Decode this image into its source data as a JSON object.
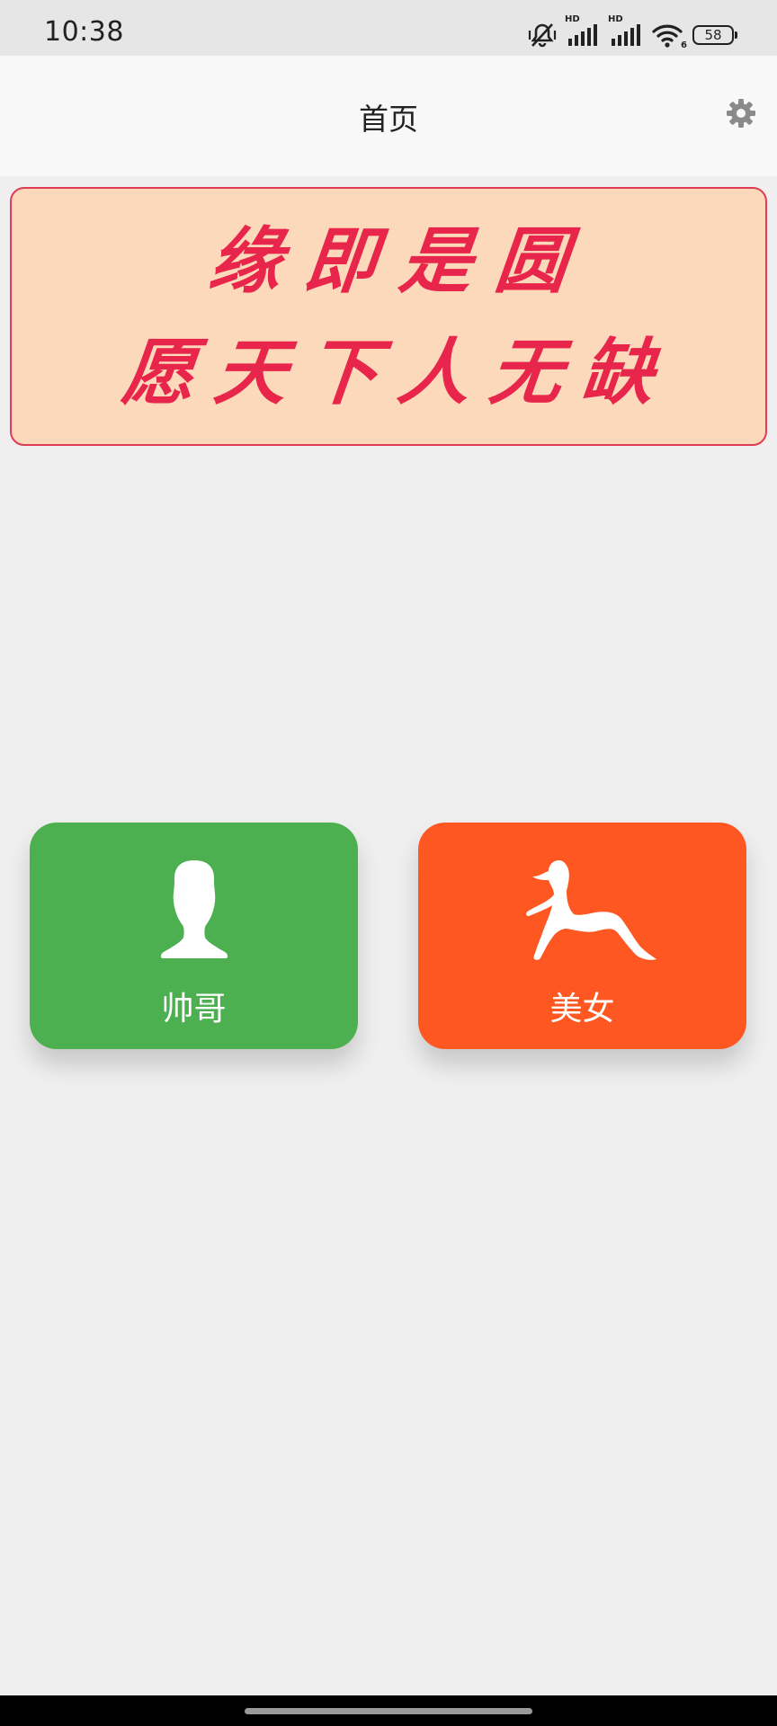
{
  "status_bar": {
    "time": "10:38",
    "battery": "58",
    "signal_label_1": "HD",
    "signal_label_2": "HD",
    "wifi_label": "6"
  },
  "app_bar": {
    "title": "首页",
    "settings_icon": "gear-icon"
  },
  "banner": {
    "line1": "缘即是圆",
    "line2": "愿天下人无缺",
    "text_color": "#e8254a",
    "background": "#fcd9bb",
    "border_color": "#e03b55"
  },
  "cards": {
    "male": {
      "label": "帅哥",
      "icon": "male-silhouette-icon",
      "color": "#4caf50"
    },
    "female": {
      "label": "美女",
      "icon": "female-silhouette-icon",
      "color": "#ff5722"
    }
  }
}
